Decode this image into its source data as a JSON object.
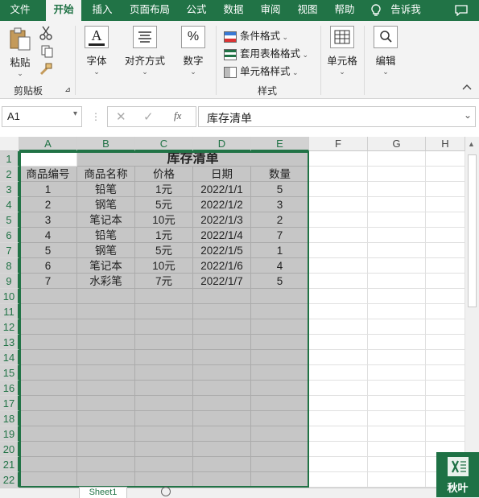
{
  "tabs": [
    "文件",
    "开始",
    "插入",
    "页面布局",
    "公式",
    "数据",
    "审阅",
    "视图",
    "帮助",
    "告诉我"
  ],
  "ribbon": {
    "paste": "粘贴",
    "clipboard": "剪贴板",
    "font": "字体",
    "font_glyph": "A",
    "align": "对齐方式",
    "number": "数字",
    "number_glyph": "%",
    "cond_format": "条件格式",
    "table_format": "套用表格格式",
    "cell_style": "单元格样式",
    "styles": "样式",
    "cells": "单元格",
    "edit": "编辑"
  },
  "formula_bar": {
    "name_box": "A1",
    "fx": "fx",
    "content": "库存清单"
  },
  "columns": [
    "A",
    "B",
    "C",
    "D",
    "E",
    "F",
    "G",
    "H"
  ],
  "rows": [
    "1",
    "2",
    "3",
    "4",
    "5",
    "6",
    "7",
    "8",
    "9",
    "10",
    "11",
    "12",
    "13",
    "14",
    "15",
    "16",
    "17",
    "18",
    "19",
    "20",
    "21",
    "22"
  ],
  "sheet": {
    "title": "库存清单",
    "headers": [
      "商品编号",
      "商品名称",
      "价格",
      "日期",
      "数量"
    ],
    "data": [
      [
        "1",
        "铅笔",
        "1元",
        "2022/1/1",
        "5"
      ],
      [
        "2",
        "钢笔",
        "5元",
        "2022/1/2",
        "3"
      ],
      [
        "3",
        "笔记本",
        "10元",
        "2022/1/3",
        "2"
      ],
      [
        "4",
        "铅笔",
        "1元",
        "2022/1/4",
        "7"
      ],
      [
        "5",
        "钢笔",
        "5元",
        "2022/1/5",
        "1"
      ],
      [
        "6",
        "笔记本",
        "10元",
        "2022/1/6",
        "4"
      ],
      [
        "7",
        "水彩笔",
        "7元",
        "2022/1/7",
        "5"
      ]
    ]
  },
  "sheet_tab": "Sheet1",
  "watermark": "秋叶",
  "colors": {
    "excel_green": "#217346",
    "selection": "#c6c6c6"
  }
}
